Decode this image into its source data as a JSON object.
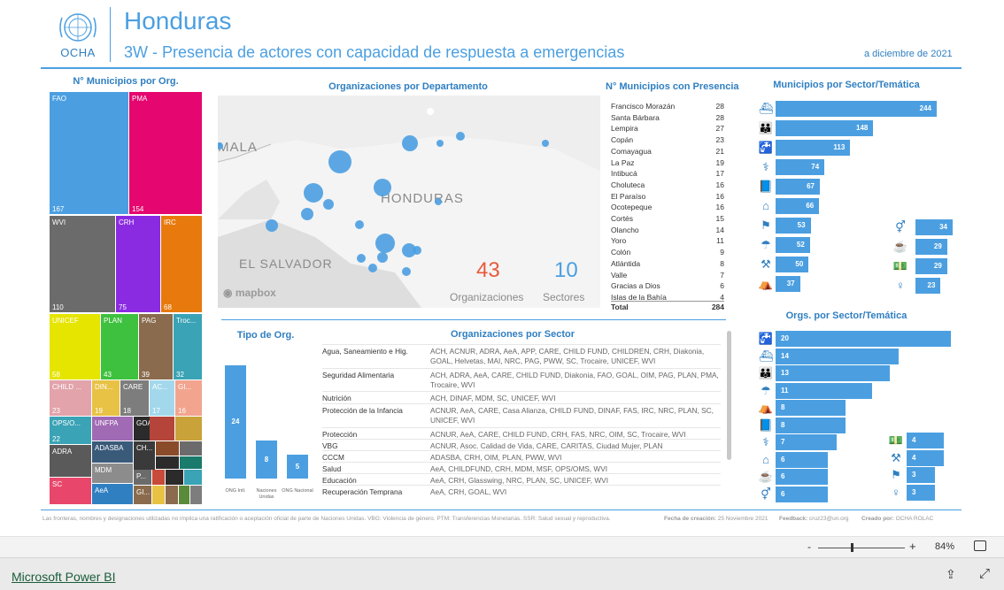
{
  "header": {
    "logo_text": "OCHA",
    "title": "Honduras",
    "subtitle": "3W - Presencia de actores con capacidad de respuesta a emergencias",
    "date": "a diciembre de 2021"
  },
  "treemap": {
    "title": "N° Municipios por Org.",
    "tiles": [
      {
        "label": "FAO",
        "value": "167",
        "color": "#4b9fe1"
      },
      {
        "label": "PMA",
        "value": "154",
        "color": "#e5066f"
      },
      {
        "label": "WVI",
        "value": "110",
        "color": "#6b6b6b"
      },
      {
        "label": "CRH",
        "value": "75",
        "color": "#8a2be2"
      },
      {
        "label": "IRC",
        "value": "68",
        "color": "#e8790c"
      },
      {
        "label": "UNICEF",
        "value": "58",
        "color": "#e5e500"
      },
      {
        "label": "PLAN",
        "value": "43",
        "color": "#3ec13e"
      },
      {
        "label": "PAG",
        "value": "39",
        "color": "#8a6b4d"
      },
      {
        "label": "Troc...",
        "value": "32",
        "color": "#3aa3b5"
      },
      {
        "label": "CHILD ...",
        "value": "23",
        "color": "#e2a3ab"
      },
      {
        "label": "DIN...",
        "value": "19",
        "color": "#e8c244"
      },
      {
        "label": "CARE",
        "value": "18",
        "color": "#7d7d7d"
      },
      {
        "label": "AC...",
        "value": "17",
        "color": "#a3d8ec"
      },
      {
        "label": "GI...",
        "value": "16",
        "color": "#f2a48f"
      },
      {
        "label": "OPS/O...",
        "value": "22",
        "color": "#3aa3b5"
      },
      {
        "label": "UNFPA",
        "value": "",
        "color": "#a06ab4"
      },
      {
        "label": "GOAL",
        "value": "",
        "color": "#2b2b2b"
      },
      {
        "label": "ADRA",
        "value": "",
        "color": "#5a5a5a"
      },
      {
        "label": "ADASBA",
        "value": "",
        "color": "#3a5a7a"
      },
      {
        "label": "CH...",
        "value": "",
        "color": "#3a3a3a"
      },
      {
        "label": "MDM",
        "value": "",
        "color": "#8c8c8c"
      },
      {
        "label": "P...",
        "value": "",
        "color": "#6b6b6b"
      },
      {
        "label": "SC",
        "value": "",
        "color": "#e8476b"
      },
      {
        "label": "AeA",
        "value": "",
        "color": "#2f7fc1"
      },
      {
        "label": "GI...",
        "value": "",
        "color": "#8a6b4d"
      }
    ]
  },
  "map": {
    "title": "Organizaciones por Departamento",
    "labels": {
      "guatemala": "MALA",
      "honduras": "HONDURAS",
      "el_salvador": "EL SALVADOR",
      "mapbox": "mapbox"
    },
    "kpi_orgs_value": "43",
    "kpi_orgs_label": "Organizaciones",
    "kpi_sect_value": "10",
    "kpi_sect_label": "Sectores"
  },
  "municipios": {
    "title": "N° Municipios con Presencia",
    "rows": [
      {
        "name": "Francisco Morazán",
        "count": "28"
      },
      {
        "name": "Santa Bárbara",
        "count": "28"
      },
      {
        "name": "Lempira",
        "count": "27"
      },
      {
        "name": "Copán",
        "count": "23"
      },
      {
        "name": "Comayagua",
        "count": "21"
      },
      {
        "name": "La Paz",
        "count": "19"
      },
      {
        "name": "Intibucá",
        "count": "17"
      },
      {
        "name": "Choluteca",
        "count": "16"
      },
      {
        "name": "El Paraíso",
        "count": "16"
      },
      {
        "name": "Ocotepeque",
        "count": "16"
      },
      {
        "name": "Cortés",
        "count": "15"
      },
      {
        "name": "Olancho",
        "count": "14"
      },
      {
        "name": "Yoro",
        "count": "11"
      },
      {
        "name": "Colón",
        "count": "9"
      },
      {
        "name": "Atlántida",
        "count": "8"
      },
      {
        "name": "Valle",
        "count": "7"
      },
      {
        "name": "Gracias a Dios",
        "count": "6"
      },
      {
        "name": "Islas de la Bahía",
        "count": "4"
      }
    ],
    "total_label": "Total",
    "total_value": "284"
  },
  "sector_municipios": {
    "title": "Municipios por Sector/Temática",
    "left": [
      {
        "icon": "boat-icon",
        "glyph": "⛴",
        "value": 244
      },
      {
        "icon": "family-icon",
        "glyph": "👪",
        "value": 148
      },
      {
        "icon": "water-tap-icon",
        "glyph": "🚰",
        "value": 113
      },
      {
        "icon": "health-icon",
        "glyph": "⚕",
        "value": 74
      },
      {
        "icon": "education-icon",
        "glyph": "📘",
        "value": 67
      },
      {
        "icon": "shelter-icon",
        "glyph": "⌂",
        "value": 66
      },
      {
        "icon": "protection-icon",
        "glyph": "⚑",
        "value": 53
      },
      {
        "icon": "child-protection-icon",
        "glyph": "☂",
        "value": 52
      },
      {
        "icon": "early-recovery-icon",
        "glyph": "⚒",
        "value": 50
      },
      {
        "icon": "camp-coordination-icon",
        "glyph": "⛺",
        "value": 37
      }
    ],
    "right": [
      {
        "icon": "gbv-icon",
        "glyph": "⚥",
        "value": 34
      },
      {
        "icon": "nutrition-icon",
        "glyph": "☕",
        "value": 29
      },
      {
        "icon": "cash-icon",
        "glyph": "💵",
        "value": 29
      },
      {
        "icon": "srh-icon",
        "glyph": "♀",
        "value": 23
      }
    ]
  },
  "sector_orgs": {
    "title": "Orgs. por Sector/Temática",
    "left": [
      {
        "icon": "water-tap-icon",
        "glyph": "🚰",
        "value": 20
      },
      {
        "icon": "boat-icon",
        "glyph": "⛴",
        "value": 14
      },
      {
        "icon": "family-icon",
        "glyph": "👪",
        "value": 13
      },
      {
        "icon": "child-protection-icon",
        "glyph": "☂",
        "value": 11
      },
      {
        "icon": "camp-coordination-icon",
        "glyph": "⛺",
        "value": 8
      },
      {
        "icon": "education-icon",
        "glyph": "📘",
        "value": 8
      },
      {
        "icon": "health-icon",
        "glyph": "⚕",
        "value": 7
      },
      {
        "icon": "shelter-icon",
        "glyph": "⌂",
        "value": 6
      },
      {
        "icon": "nutrition-icon",
        "glyph": "☕",
        "value": 6
      },
      {
        "icon": "gbv-icon",
        "glyph": "⚥",
        "value": 6
      }
    ],
    "right": [
      {
        "icon": "cash-icon",
        "glyph": "💵",
        "value": 4
      },
      {
        "icon": "early-recovery-icon",
        "glyph": "⚒",
        "value": 4
      },
      {
        "icon": "protection-icon",
        "glyph": "⚑",
        "value": 3
      },
      {
        "icon": "srh-icon",
        "glyph": "♀",
        "value": 3
      }
    ]
  },
  "tipo_org": {
    "title": "Tipo de Org.",
    "bars": [
      {
        "label": "ONG Intl.",
        "value": 24
      },
      {
        "label": "Naciones Unidas",
        "value": 8
      },
      {
        "label": "ONG Nacional",
        "value": 5
      }
    ]
  },
  "orgs_sector": {
    "title": "Organizaciones por Sector",
    "rows": [
      {
        "sector": "Agua, Saneamiento e Hig.",
        "orgs": "ACH, ACNUR, ADRA, AeA, APP, CARE, CHILD FUND, CHILDREN, CRH, Diakonia, GOAL, Helvetas, MAI, NRC, PAG, PWW, SC, Trocaire, UNICEF, WVI"
      },
      {
        "sector": "Seguridad Alimentaria",
        "orgs": "ACH, ADRA, AeA, CARE, CHILD FUND, Diakonia, FAO, GOAL, OIM, PAG, PLAN, PMA, Trocaire, WVI"
      },
      {
        "sector": "Nutrición",
        "orgs": "ACH, DINAF, MDM, SC, UNICEF, WVI"
      },
      {
        "sector": "Protección de la Infancia",
        "orgs": "ACNUR, AeA, CARE, Casa Alianza, CHILD FUND, DINAF, FAS, IRC, NRC, PLAN, SC, UNICEF, WVI"
      },
      {
        "sector": "Protección",
        "orgs": "ACNUR, AeA, CARE, CHILD FUND, CRH, FAS, NRC, OIM, SC, Trocaire, WVI"
      },
      {
        "sector": "VBG",
        "orgs": "ACNUR, Asoc. Calidad de Vida, CARE, CARITAS, Ciudad Mujer, PLAN"
      },
      {
        "sector": "CCCM",
        "orgs": "ADASBA, CRH, OIM, PLAN, PWW, WVI"
      },
      {
        "sector": "Salud",
        "orgs": "AeA, CHILDFUND, CRH, MDM, MSF, OPS/OMS, WVI"
      },
      {
        "sector": "Educación",
        "orgs": "AeA, CRH, Glasswing, NRC, PLAN, SC, UNICEF, WVI"
      },
      {
        "sector": "Recuperación Temprana",
        "orgs": "AeA, CRH, GOAL, WVI"
      }
    ]
  },
  "footer": {
    "disclaimer": "Las fronteras, nombres y designaciones utilizadas no implica una ratificación o aceptación oficial de parte de Naciones Unidas. VBG: Violencia de género. PTM: Transferencias Monetarias. SSR: Salud sexual y reproductiva.",
    "created_label": "Fecha de creación:",
    "created_value": "25 Noviembre 2021",
    "feedback_label": "Feedback:",
    "feedback_value": "cruz23@un.org",
    "creator_label": "Creado por:",
    "creator_value": "OCHA ROLAC"
  },
  "powerbi": {
    "zoom": "84%",
    "zoom_minus": "-",
    "zoom_plus": "+",
    "brand": "Microsoft Power BI"
  },
  "colors": {
    "accent": "#4b9fe1",
    "title_blue": "#2f7fc1",
    "kpi_red": "#e8593b"
  }
}
